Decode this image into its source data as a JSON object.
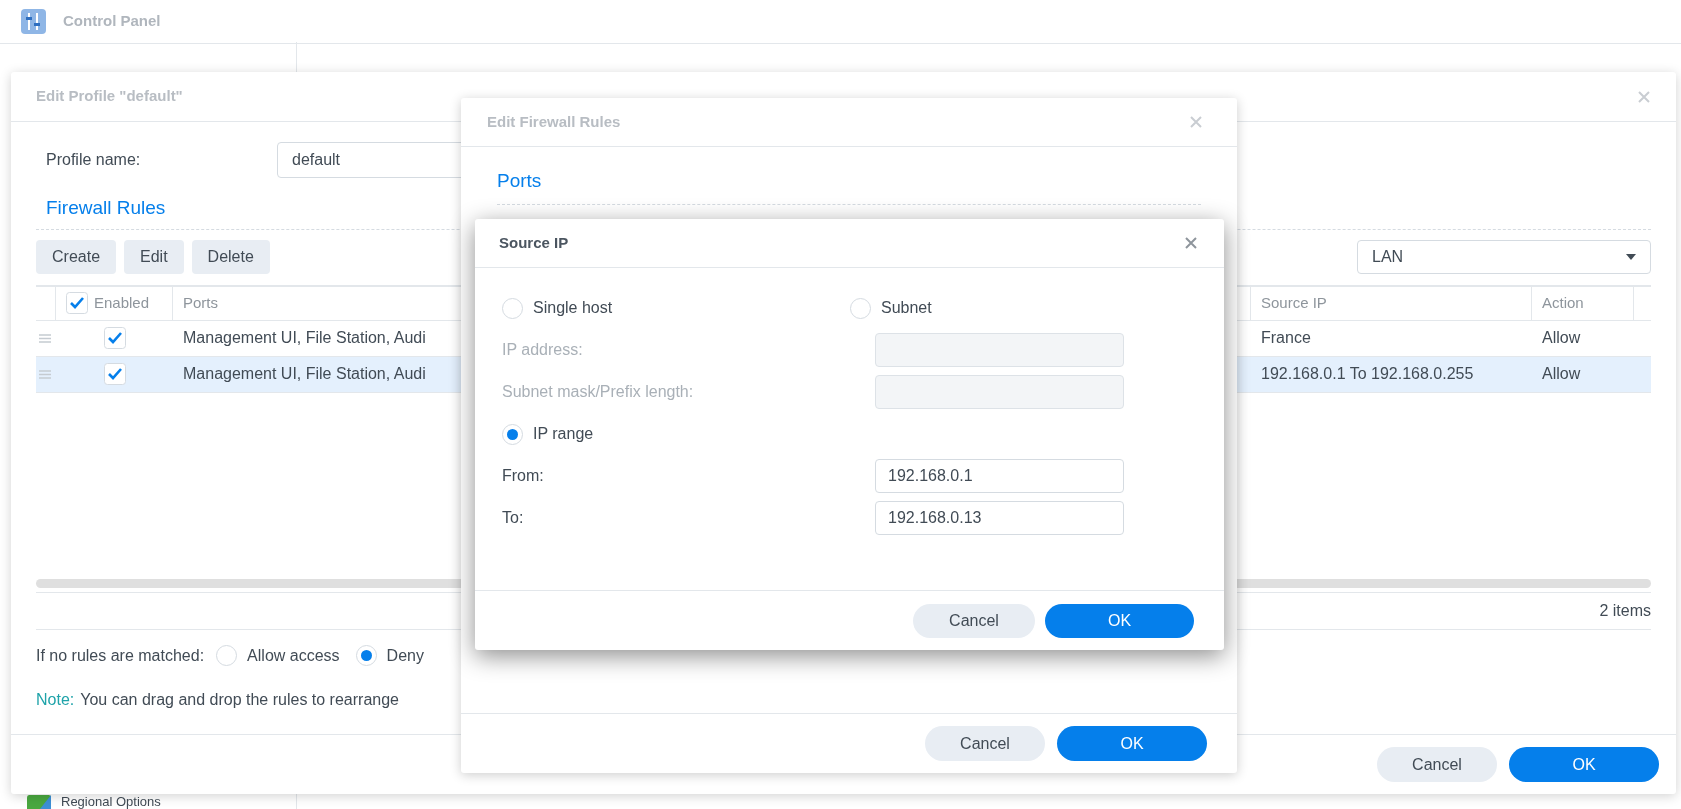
{
  "app": {
    "title": "Control Panel"
  },
  "sidebar": {
    "items": [
      {
        "label": "Regional Options"
      }
    ]
  },
  "profile_dialog": {
    "title": "Edit Profile \"default\"",
    "profile_name": {
      "label": "Profile name:",
      "value": "default"
    },
    "section": "Firewall Rules",
    "toolbar": [
      "Create",
      "Edit",
      "Delete"
    ],
    "interface_select": {
      "value": "LAN"
    },
    "table": {
      "select_all": {
        "label": "Enabled",
        "checked": true
      },
      "columns": [
        "Ports",
        "Source IP",
        "Action"
      ],
      "rows": [
        {
          "enabled": true,
          "ports": "Management UI, File Station, Audi",
          "source_ip": "France",
          "action": "Allow",
          "selected": false
        },
        {
          "enabled": true,
          "ports": "Management UI, File Station, Audi",
          "source_ip": "192.168.0.1 To 192.168.0.255",
          "action": "Allow",
          "selected": true
        }
      ]
    },
    "item_count": "2 items",
    "default_policy": {
      "label": "If no rules are matched:",
      "options": [
        {
          "label": "Allow access",
          "selected": false
        },
        {
          "label": "Deny",
          "selected": true
        }
      ]
    },
    "note": {
      "label": "Note:",
      "text": "You can drag and drop the rules to rearrange"
    },
    "buttons": [
      {
        "label": "Cancel",
        "kind": "secondary"
      },
      {
        "label": "OK",
        "kind": "primary"
      }
    ]
  },
  "rules_dialog": {
    "title": "Edit Firewall Rules",
    "section": "Ports",
    "buttons": [
      {
        "label": "Cancel",
        "kind": "secondary"
      },
      {
        "label": "OK",
        "kind": "primary"
      }
    ]
  },
  "source_ip_dialog": {
    "title": "Source IP",
    "modes": [
      {
        "label": "Single host",
        "selected": false
      },
      {
        "label": "Subnet",
        "selected": false
      },
      {
        "label": "IP range",
        "selected": true
      }
    ],
    "subnet_fields": [
      {
        "label": "IP address:",
        "disabled": true
      },
      {
        "label": "Subnet mask/Prefix length:",
        "disabled": true
      }
    ],
    "range_fields": [
      {
        "label": "From:",
        "value": "192.168.0.1"
      },
      {
        "label": "To:",
        "value": "192.168.0.13"
      }
    ],
    "buttons": [
      {
        "label": "Cancel",
        "kind": "secondary"
      },
      {
        "label": "OK",
        "kind": "primary"
      }
    ]
  }
}
